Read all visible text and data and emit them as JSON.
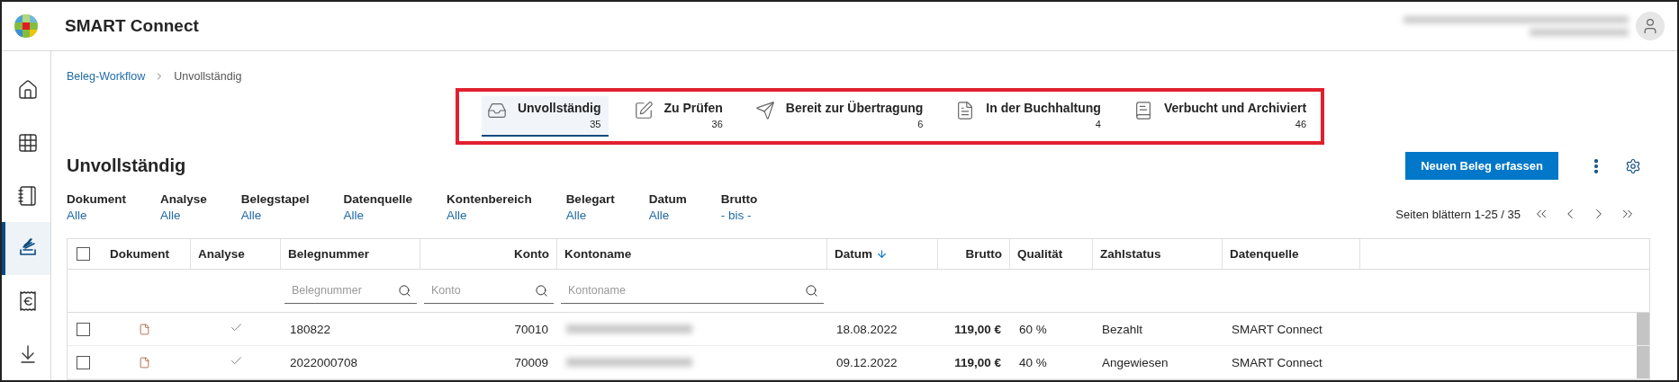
{
  "app": {
    "title": "SMART Connect"
  },
  "sidebar": {
    "items": [
      {
        "selected": false
      },
      {
        "selected": false
      },
      {
        "selected": false
      },
      {
        "selected": true
      },
      {
        "selected": false
      },
      {
        "selected": false
      }
    ]
  },
  "breadcrumb": [
    {
      "label": "Beleg-Workflow",
      "kind": "link"
    },
    {
      "label": "Unvollständig",
      "kind": "current"
    }
  ],
  "tabs": [
    {
      "label": "Unvollständig",
      "count": "35",
      "selected": true
    },
    {
      "label": "Zu Prüfen",
      "count": "36",
      "selected": false
    },
    {
      "label": "Bereit zur Übertragung",
      "count": "6",
      "selected": false
    },
    {
      "label": "In der Buchhaltung",
      "count": "4",
      "selected": false
    },
    {
      "label": "Verbucht und Archiviert",
      "count": "46",
      "selected": false
    }
  ],
  "page_title": "Unvollständig",
  "primary_button": "Neuen Beleg erfassen",
  "filters": [
    {
      "label": "Dokument",
      "value": "Alle"
    },
    {
      "label": "Analyse",
      "value": "Alle"
    },
    {
      "label": "Belegstapel",
      "value": "Alle"
    },
    {
      "label": "Datenquelle",
      "value": "Alle"
    },
    {
      "label": "Kontenbereich",
      "value": "Alle"
    },
    {
      "label": "Belegart",
      "value": "Alle"
    },
    {
      "label": "Datum",
      "value": "Alle"
    },
    {
      "label": "Brutto",
      "value": "- bis -"
    }
  ],
  "pagination": {
    "label": "Seiten blättern 1-25 / 35"
  },
  "table": {
    "select_all": {
      "checked": false
    },
    "columns": [
      {
        "label": "Dokument",
        "sorted": false
      },
      {
        "label": "Analyse",
        "sorted": false
      },
      {
        "label": "Belegnummer",
        "sorted": false,
        "placeholder": "Belegnummer"
      },
      {
        "label": "Konto",
        "sorted": false,
        "placeholder": "Konto"
      },
      {
        "label": "Kontoname",
        "sorted": false,
        "placeholder": "Kontoname"
      },
      {
        "label": "Datum",
        "sorted": true
      },
      {
        "label": "Brutto",
        "sorted": false
      },
      {
        "label": "Qualität",
        "sorted": false
      },
      {
        "label": "Zahlstatus",
        "sorted": false
      },
      {
        "label": "Datenquelle",
        "sorted": false
      }
    ],
    "rows": [
      {
        "checked": false,
        "analysed": true,
        "belegnummer": "180822",
        "konto": "70010",
        "datum": "18.08.2022",
        "brutto": "119,00 €",
        "qualitaet": "60 %",
        "zahlstatus": "Bezahlt",
        "datenquelle": "SMART Connect"
      },
      {
        "checked": false,
        "analysed": true,
        "belegnummer": "2022000708",
        "konto": "70009",
        "datum": "09.12.2022",
        "brutto": "119,00 €",
        "qualitaet": "40 %",
        "zahlstatus": "Angewiesen",
        "datenquelle": "SMART Connect"
      }
    ]
  }
}
